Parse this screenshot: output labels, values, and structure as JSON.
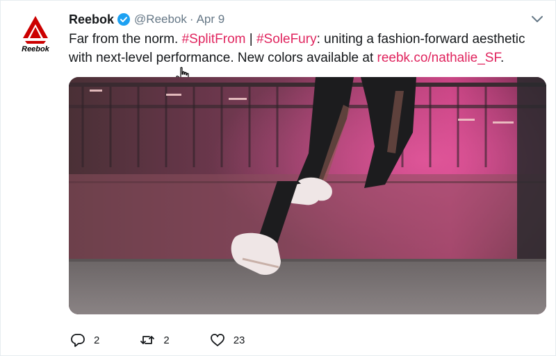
{
  "tweet": {
    "display_name": "Reebok",
    "handle": "@Reebok",
    "separator": "·",
    "date": "Apr 9",
    "text": {
      "part1": "Far from the norm. ",
      "hashtag1": "#SplitFrom",
      "part2": " | ",
      "hashtag2": "#SoleFury",
      "part3": ": uniting a fashion-forward aesthetic with next-level performance. New colors available at ",
      "link": "reebk.co/nathalie_SF",
      "part4": "."
    },
    "avatar_logo_text": "Reebok",
    "actions": {
      "replies": "2",
      "retweets": "2",
      "likes": "23"
    }
  },
  "colors": {
    "link": "#e0245e",
    "muted": "#657786",
    "verified": "#1da1f2",
    "brand": "#cc0000"
  },
  "icons": [
    "verified-badge-icon",
    "chevron-down-icon",
    "hand-cursor-icon",
    "reply-icon",
    "retweet-icon",
    "like-icon"
  ]
}
